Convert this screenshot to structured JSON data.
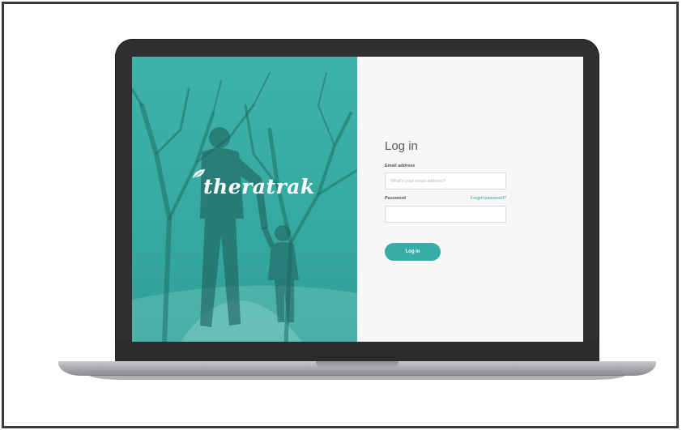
{
  "brand": {
    "logo_text": "theratrak",
    "accent": "#36aea5"
  },
  "login": {
    "title": "Log in",
    "email_label": "Email address",
    "email_placeholder": "What's your email address?",
    "email_value": "",
    "password_label": "Password",
    "password_value": "",
    "forgot_link": "Forgot password?",
    "submit_label": "Log in"
  }
}
